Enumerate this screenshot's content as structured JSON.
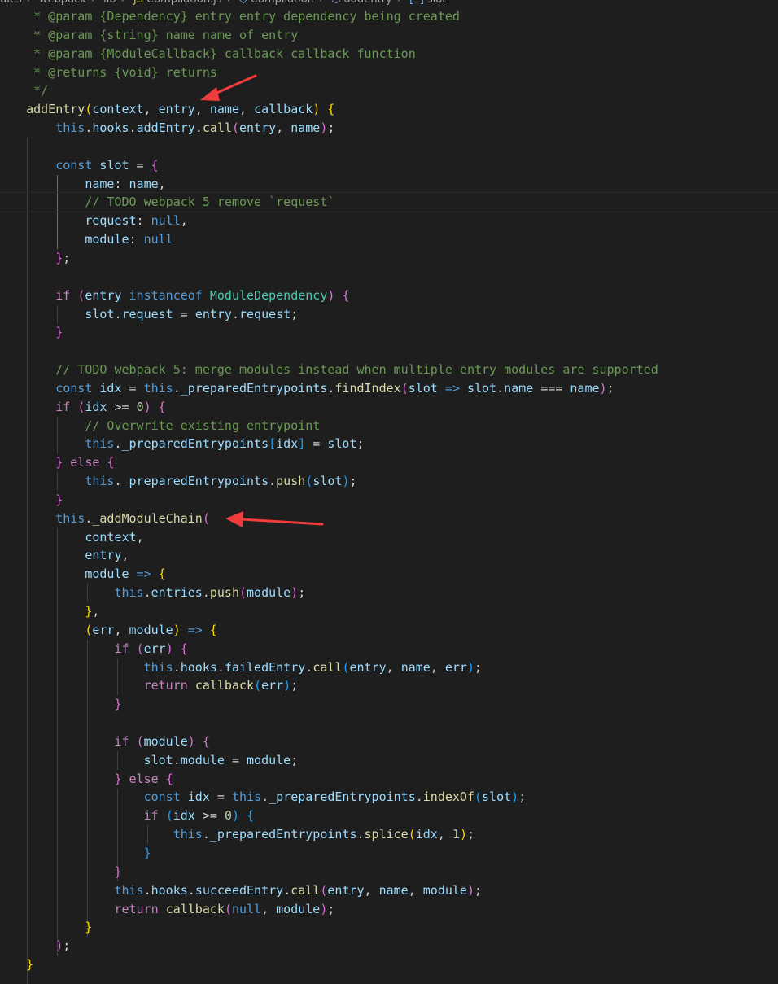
{
  "breadcrumb": {
    "items": [
      "ules",
      "webpack",
      "lib",
      "Compilation.js",
      "Compilation",
      "addEntry",
      "slot"
    ]
  },
  "colors": {
    "background": "#1e1e1e",
    "arrow": "#f03c3c",
    "keyword": "#569cd6",
    "control": "#c586c0",
    "function": "#dcdcaa",
    "variable": "#9cdcfe",
    "class": "#4ec9b0",
    "number": "#b5cea8",
    "comment": "#6a9955"
  },
  "annotations": [
    {
      "name": "arrow-to-addEntry-params",
      "color": "#f03c3c"
    },
    {
      "name": "arrow-to-addModuleChain",
      "color": "#f03c3c"
    }
  ],
  "code_lines": [
    {
      "indent": 4,
      "tokens": [
        [
          "cmt",
          "* @param {Dependency} entry entry dependency being created"
        ]
      ]
    },
    {
      "indent": 4,
      "tokens": [
        [
          "cmt",
          "* @param {string} name name of entry"
        ]
      ]
    },
    {
      "indent": 4,
      "tokens": [
        [
          "cmt",
          "* @param {ModuleCallback} callback callback function"
        ]
      ]
    },
    {
      "indent": 4,
      "tokens": [
        [
          "cmt",
          "* @returns {void} returns"
        ]
      ]
    },
    {
      "indent": 4,
      "tokens": [
        [
          "cmt",
          "*/"
        ]
      ]
    },
    {
      "indent": 3,
      "tokens": [
        [
          "fn",
          "addEntry"
        ],
        [
          "br1",
          "("
        ],
        [
          "var",
          "context"
        ],
        [
          "plain",
          ", "
        ],
        [
          "var",
          "entry"
        ],
        [
          "plain",
          ", "
        ],
        [
          "var",
          "name"
        ],
        [
          "plain",
          ", "
        ],
        [
          "var",
          "callback"
        ],
        [
          "br1",
          ")"
        ],
        [
          "plain",
          " "
        ],
        [
          "br1",
          "{"
        ]
      ]
    },
    {
      "indent": 7,
      "tokens": [
        [
          "kw",
          "this"
        ],
        [
          "plain",
          "."
        ],
        [
          "var",
          "hooks"
        ],
        [
          "plain",
          "."
        ],
        [
          "var",
          "addEntry"
        ],
        [
          "plain",
          "."
        ],
        [
          "fn",
          "call"
        ],
        [
          "br2",
          "("
        ],
        [
          "var",
          "entry"
        ],
        [
          "plain",
          ", "
        ],
        [
          "var",
          "name"
        ],
        [
          "br2",
          ")"
        ],
        [
          "plain",
          ";"
        ]
      ]
    },
    {
      "indent": 0,
      "tokens": []
    },
    {
      "indent": 7,
      "tokens": [
        [
          "kw",
          "const"
        ],
        [
          "plain",
          " "
        ],
        [
          "var",
          "slot"
        ],
        [
          "plain",
          " = "
        ],
        [
          "br2",
          "{"
        ]
      ]
    },
    {
      "indent": 11,
      "tokens": [
        [
          "var",
          "name"
        ],
        [
          "plain",
          ": "
        ],
        [
          "var",
          "name"
        ],
        [
          "plain",
          ","
        ]
      ]
    },
    {
      "indent": 11,
      "tokens": [
        [
          "cmt",
          "// TODO webpack 5 remove `request`"
        ]
      ]
    },
    {
      "indent": 11,
      "tokens": [
        [
          "var",
          "request"
        ],
        [
          "plain",
          ": "
        ],
        [
          "kw",
          "null"
        ],
        [
          "plain",
          ","
        ]
      ]
    },
    {
      "indent": 11,
      "tokens": [
        [
          "var",
          "module"
        ],
        [
          "plain",
          ": "
        ],
        [
          "kw",
          "null"
        ]
      ]
    },
    {
      "indent": 7,
      "tokens": [
        [
          "br2",
          "}"
        ],
        [
          "plain",
          ";"
        ]
      ]
    },
    {
      "indent": 0,
      "tokens": []
    },
    {
      "indent": 7,
      "tokens": [
        [
          "ctl",
          "if"
        ],
        [
          "plain",
          " "
        ],
        [
          "br2",
          "("
        ],
        [
          "var",
          "entry"
        ],
        [
          "plain",
          " "
        ],
        [
          "kw",
          "instanceof"
        ],
        [
          "plain",
          " "
        ],
        [
          "cls",
          "ModuleDependency"
        ],
        [
          "br2",
          ")"
        ],
        [
          "plain",
          " "
        ],
        [
          "br2",
          "{"
        ]
      ]
    },
    {
      "indent": 11,
      "tokens": [
        [
          "var",
          "slot"
        ],
        [
          "plain",
          "."
        ],
        [
          "var",
          "request"
        ],
        [
          "plain",
          " = "
        ],
        [
          "var",
          "entry"
        ],
        [
          "plain",
          "."
        ],
        [
          "var",
          "request"
        ],
        [
          "plain",
          ";"
        ]
      ]
    },
    {
      "indent": 7,
      "tokens": [
        [
          "br2",
          "}"
        ]
      ]
    },
    {
      "indent": 0,
      "tokens": []
    },
    {
      "indent": 7,
      "tokens": [
        [
          "cmt",
          "// TODO webpack 5: merge modules instead when multiple entry modules are supported"
        ]
      ]
    },
    {
      "indent": 7,
      "tokens": [
        [
          "kw",
          "const"
        ],
        [
          "plain",
          " "
        ],
        [
          "var",
          "idx"
        ],
        [
          "plain",
          " = "
        ],
        [
          "kw",
          "this"
        ],
        [
          "plain",
          "."
        ],
        [
          "var",
          "_preparedEntrypoints"
        ],
        [
          "plain",
          "."
        ],
        [
          "fn",
          "findIndex"
        ],
        [
          "br2",
          "("
        ],
        [
          "var",
          "slot"
        ],
        [
          "plain",
          " "
        ],
        [
          "kw",
          "=>"
        ],
        [
          "plain",
          " "
        ],
        [
          "var",
          "slot"
        ],
        [
          "plain",
          "."
        ],
        [
          "var",
          "name"
        ],
        [
          "plain",
          " === "
        ],
        [
          "var",
          "name"
        ],
        [
          "br2",
          ")"
        ],
        [
          "plain",
          ";"
        ]
      ]
    },
    {
      "indent": 7,
      "tokens": [
        [
          "ctl",
          "if"
        ],
        [
          "plain",
          " "
        ],
        [
          "br2",
          "("
        ],
        [
          "var",
          "idx"
        ],
        [
          "plain",
          " >= "
        ],
        [
          "num",
          "0"
        ],
        [
          "br2",
          ")"
        ],
        [
          "plain",
          " "
        ],
        [
          "br2",
          "{"
        ]
      ]
    },
    {
      "indent": 11,
      "tokens": [
        [
          "cmt",
          "// Overwrite existing entrypoint"
        ]
      ]
    },
    {
      "indent": 11,
      "tokens": [
        [
          "kw",
          "this"
        ],
        [
          "plain",
          "."
        ],
        [
          "var",
          "_preparedEntrypoints"
        ],
        [
          "br3",
          "["
        ],
        [
          "var",
          "idx"
        ],
        [
          "br3",
          "]"
        ],
        [
          "plain",
          " = "
        ],
        [
          "var",
          "slot"
        ],
        [
          "plain",
          ";"
        ]
      ]
    },
    {
      "indent": 7,
      "tokens": [
        [
          "br2",
          "}"
        ],
        [
          "plain",
          " "
        ],
        [
          "ctl",
          "else"
        ],
        [
          "plain",
          " "
        ],
        [
          "br2",
          "{"
        ]
      ]
    },
    {
      "indent": 11,
      "tokens": [
        [
          "kw",
          "this"
        ],
        [
          "plain",
          "."
        ],
        [
          "var",
          "_preparedEntrypoints"
        ],
        [
          "plain",
          "."
        ],
        [
          "fn",
          "push"
        ],
        [
          "br3",
          "("
        ],
        [
          "var",
          "slot"
        ],
        [
          "br3",
          ")"
        ],
        [
          "plain",
          ";"
        ]
      ]
    },
    {
      "indent": 7,
      "tokens": [
        [
          "br2",
          "}"
        ]
      ]
    },
    {
      "indent": 7,
      "tokens": [
        [
          "kw",
          "this"
        ],
        [
          "plain",
          "."
        ],
        [
          "fn",
          "_addModuleChain"
        ],
        [
          "br2",
          "("
        ]
      ]
    },
    {
      "indent": 11,
      "tokens": [
        [
          "var",
          "context"
        ],
        [
          "plain",
          ","
        ]
      ]
    },
    {
      "indent": 11,
      "tokens": [
        [
          "var",
          "entry"
        ],
        [
          "plain",
          ","
        ]
      ]
    },
    {
      "indent": 11,
      "tokens": [
        [
          "var",
          "module"
        ],
        [
          "plain",
          " "
        ],
        [
          "kw",
          "=>"
        ],
        [
          "plain",
          " "
        ],
        [
          "br1",
          "{"
        ]
      ]
    },
    {
      "indent": 15,
      "tokens": [
        [
          "kw",
          "this"
        ],
        [
          "plain",
          "."
        ],
        [
          "var",
          "entries"
        ],
        [
          "plain",
          "."
        ],
        [
          "fn",
          "push"
        ],
        [
          "br2",
          "("
        ],
        [
          "var",
          "module"
        ],
        [
          "br2",
          ")"
        ],
        [
          "plain",
          ";"
        ]
      ]
    },
    {
      "indent": 11,
      "tokens": [
        [
          "br1",
          "}"
        ],
        [
          "plain",
          ","
        ]
      ]
    },
    {
      "indent": 11,
      "tokens": [
        [
          "br1",
          "("
        ],
        [
          "var",
          "err"
        ],
        [
          "plain",
          ", "
        ],
        [
          "var",
          "module"
        ],
        [
          "br1",
          ")"
        ],
        [
          "plain",
          " "
        ],
        [
          "kw",
          "=>"
        ],
        [
          "plain",
          " "
        ],
        [
          "br1",
          "{"
        ]
      ]
    },
    {
      "indent": 15,
      "tokens": [
        [
          "ctl",
          "if"
        ],
        [
          "plain",
          " "
        ],
        [
          "br2",
          "("
        ],
        [
          "var",
          "err"
        ],
        [
          "br2",
          ")"
        ],
        [
          "plain",
          " "
        ],
        [
          "br2",
          "{"
        ]
      ]
    },
    {
      "indent": 19,
      "tokens": [
        [
          "kw",
          "this"
        ],
        [
          "plain",
          "."
        ],
        [
          "var",
          "hooks"
        ],
        [
          "plain",
          "."
        ],
        [
          "var",
          "failedEntry"
        ],
        [
          "plain",
          "."
        ],
        [
          "fn",
          "call"
        ],
        [
          "br3",
          "("
        ],
        [
          "var",
          "entry"
        ],
        [
          "plain",
          ", "
        ],
        [
          "var",
          "name"
        ],
        [
          "plain",
          ", "
        ],
        [
          "var",
          "err"
        ],
        [
          "br3",
          ")"
        ],
        [
          "plain",
          ";"
        ]
      ]
    },
    {
      "indent": 19,
      "tokens": [
        [
          "ctl",
          "return"
        ],
        [
          "plain",
          " "
        ],
        [
          "fn",
          "callback"
        ],
        [
          "br3",
          "("
        ],
        [
          "var",
          "err"
        ],
        [
          "br3",
          ")"
        ],
        [
          "plain",
          ";"
        ]
      ]
    },
    {
      "indent": 15,
      "tokens": [
        [
          "br2",
          "}"
        ]
      ]
    },
    {
      "indent": 0,
      "tokens": []
    },
    {
      "indent": 15,
      "tokens": [
        [
          "ctl",
          "if"
        ],
        [
          "plain",
          " "
        ],
        [
          "br2",
          "("
        ],
        [
          "var",
          "module"
        ],
        [
          "br2",
          ")"
        ],
        [
          "plain",
          " "
        ],
        [
          "br2",
          "{"
        ]
      ]
    },
    {
      "indent": 19,
      "tokens": [
        [
          "var",
          "slot"
        ],
        [
          "plain",
          "."
        ],
        [
          "var",
          "module"
        ],
        [
          "plain",
          " = "
        ],
        [
          "var",
          "module"
        ],
        [
          "plain",
          ";"
        ]
      ]
    },
    {
      "indent": 15,
      "tokens": [
        [
          "br2",
          "}"
        ],
        [
          "plain",
          " "
        ],
        [
          "ctl",
          "else"
        ],
        [
          "plain",
          " "
        ],
        [
          "br2",
          "{"
        ]
      ]
    },
    {
      "indent": 19,
      "tokens": [
        [
          "kw",
          "const"
        ],
        [
          "plain",
          " "
        ],
        [
          "var",
          "idx"
        ],
        [
          "plain",
          " = "
        ],
        [
          "kw",
          "this"
        ],
        [
          "plain",
          "."
        ],
        [
          "var",
          "_preparedEntrypoints"
        ],
        [
          "plain",
          "."
        ],
        [
          "fn",
          "indexOf"
        ],
        [
          "br3",
          "("
        ],
        [
          "var",
          "slot"
        ],
        [
          "br3",
          ")"
        ],
        [
          "plain",
          ";"
        ]
      ]
    },
    {
      "indent": 19,
      "tokens": [
        [
          "ctl",
          "if"
        ],
        [
          "plain",
          " "
        ],
        [
          "br3",
          "("
        ],
        [
          "var",
          "idx"
        ],
        [
          "plain",
          " >= "
        ],
        [
          "num",
          "0"
        ],
        [
          "br3",
          ")"
        ],
        [
          "plain",
          " "
        ],
        [
          "br3",
          "{"
        ]
      ]
    },
    {
      "indent": 23,
      "tokens": [
        [
          "kw",
          "this"
        ],
        [
          "plain",
          "."
        ],
        [
          "var",
          "_preparedEntrypoints"
        ],
        [
          "plain",
          "."
        ],
        [
          "fn",
          "splice"
        ],
        [
          "br1",
          "("
        ],
        [
          "var",
          "idx"
        ],
        [
          "plain",
          ", "
        ],
        [
          "num",
          "1"
        ],
        [
          "br1",
          ")"
        ],
        [
          "plain",
          ";"
        ]
      ]
    },
    {
      "indent": 19,
      "tokens": [
        [
          "br3",
          "}"
        ]
      ]
    },
    {
      "indent": 15,
      "tokens": [
        [
          "br2",
          "}"
        ]
      ]
    },
    {
      "indent": 15,
      "tokens": [
        [
          "kw",
          "this"
        ],
        [
          "plain",
          "."
        ],
        [
          "var",
          "hooks"
        ],
        [
          "plain",
          "."
        ],
        [
          "var",
          "succeedEntry"
        ],
        [
          "plain",
          "."
        ],
        [
          "fn",
          "call"
        ],
        [
          "br2",
          "("
        ],
        [
          "var",
          "entry"
        ],
        [
          "plain",
          ", "
        ],
        [
          "var",
          "name"
        ],
        [
          "plain",
          ", "
        ],
        [
          "var",
          "module"
        ],
        [
          "br2",
          ")"
        ],
        [
          "plain",
          ";"
        ]
      ]
    },
    {
      "indent": 15,
      "tokens": [
        [
          "ctl",
          "return"
        ],
        [
          "plain",
          " "
        ],
        [
          "fn",
          "callback"
        ],
        [
          "br2",
          "("
        ],
        [
          "kw",
          "null"
        ],
        [
          "plain",
          ", "
        ],
        [
          "var",
          "module"
        ],
        [
          "br2",
          ")"
        ],
        [
          "plain",
          ";"
        ]
      ]
    },
    {
      "indent": 11,
      "tokens": [
        [
          "br1",
          "}"
        ]
      ]
    },
    {
      "indent": 7,
      "tokens": [
        [
          "br2",
          ")"
        ],
        [
          "plain",
          ";"
        ]
      ]
    },
    {
      "indent": 3,
      "tokens": [
        [
          "br1",
          "}"
        ]
      ]
    }
  ]
}
